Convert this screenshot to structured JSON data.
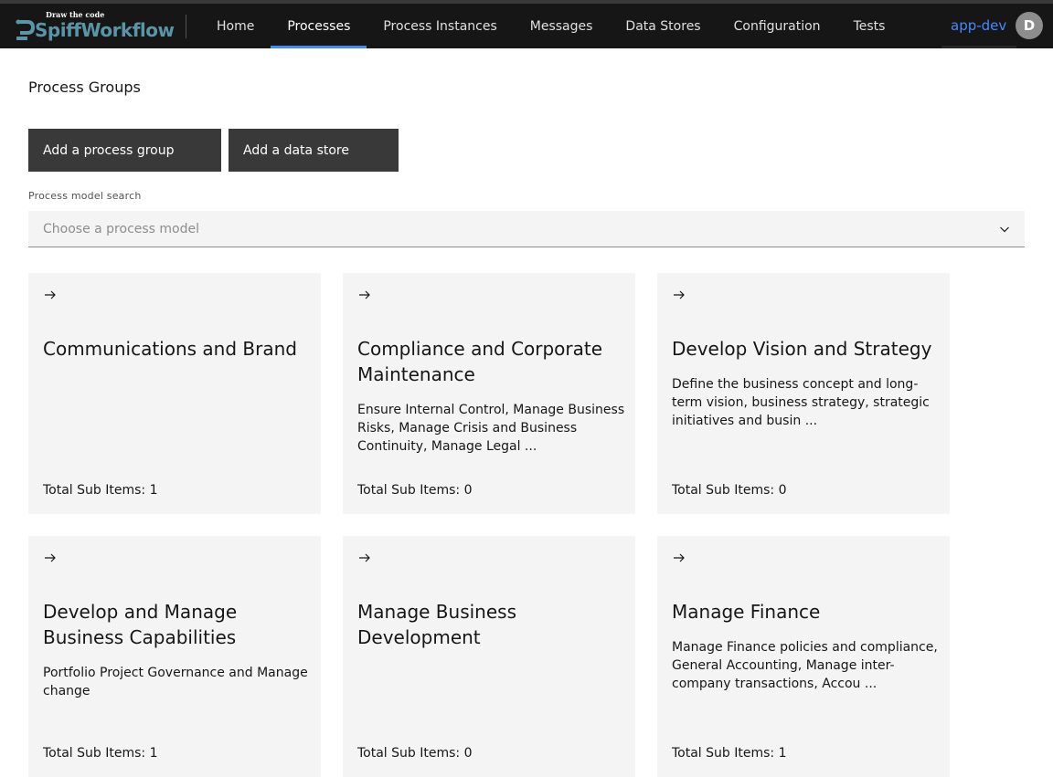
{
  "header": {
    "logo_tagline": "Draw the code",
    "logo_text": "SpiffWorkflow",
    "nav": [
      {
        "label": "Home"
      },
      {
        "label": "Processes"
      },
      {
        "label": "Process Instances"
      },
      {
        "label": "Messages"
      },
      {
        "label": "Data Stores"
      },
      {
        "label": "Configuration"
      },
      {
        "label": "Tests"
      }
    ],
    "active_nav": "Processes",
    "environment": "app-dev",
    "user_initial": "D",
    "accent_color": "#4589ff"
  },
  "page": {
    "title": "Process Groups"
  },
  "actions": {
    "add_group": "Add a process group",
    "add_store": "Add a data store"
  },
  "search": {
    "label": "Process model search",
    "placeholder": "Choose a process model"
  },
  "cards": [
    {
      "title": "Communications and Brand",
      "description": "",
      "count": "Total Sub Items: 1"
    },
    {
      "title": "Compliance and Corporate Maintenance",
      "description": "Ensure Internal Control, Manage Business Risks, Manage Crisis and Business Continuity, Manage Legal ...",
      "count": "Total Sub Items: 0"
    },
    {
      "title": "Develop Vision and Strategy",
      "description": "Define the business concept and long-term vision, business strategy, strategic initiatives and busin ...",
      "count": "Total Sub Items: 0"
    },
    {
      "title": "Develop and Manage Business Capabilities",
      "description": "Portfolio Project Governance and Manage change",
      "count": "Total Sub Items: 1"
    },
    {
      "title": "Manage Business Development",
      "description": "",
      "count": "Total Sub Items: 0"
    },
    {
      "title": "Manage Finance",
      "description": "Manage Finance policies and compliance, General Accounting, Manage inter-company transactions, Accou ...",
      "count": "Total Sub Items: 1"
    }
  ],
  "icons": {
    "card_arrow": "arrow-right-icon",
    "search_chevron": "chevron-down-icon"
  }
}
